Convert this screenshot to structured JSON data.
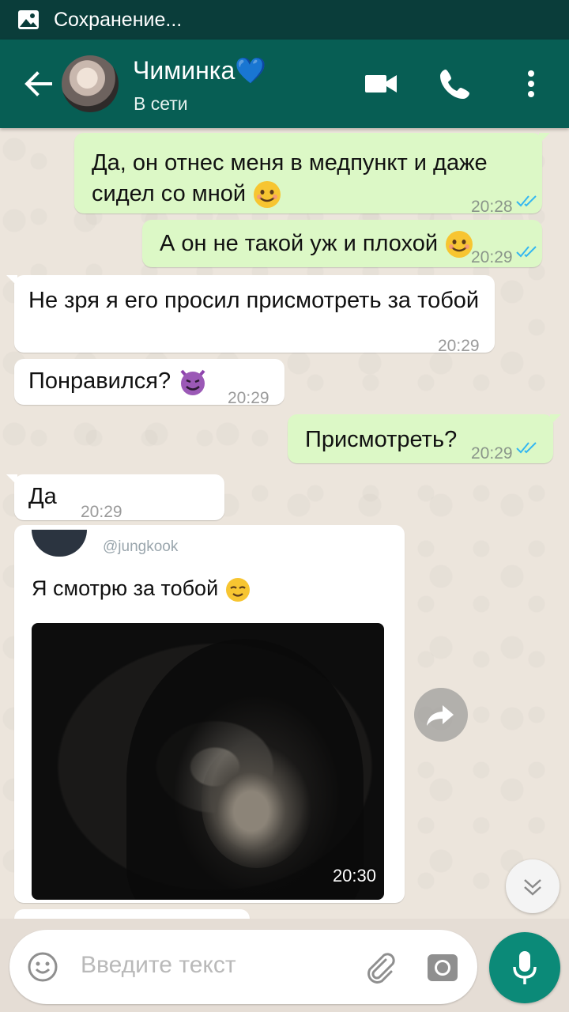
{
  "status_bar": {
    "text": "Сохранение...",
    "icon": "gallery-icon"
  },
  "header": {
    "back_icon": "arrow-back-icon",
    "contact_name": "Чиминка",
    "name_emoji": "💙",
    "presence": "В сети",
    "actions": [
      "video-call-icon",
      "voice-call-icon",
      "more-vert-icon"
    ]
  },
  "messages": [
    {
      "direction": "out",
      "lines": [
        "Да, он отнес меня в медпункт и даже",
        "сидел со мной"
      ],
      "time": "20:28",
      "status": "read"
    },
    {
      "direction": "out",
      "text": "А он не такой уж и плохой",
      "time": "20:29",
      "status": "read"
    },
    {
      "direction": "in",
      "text": "Не зря я его просил присмотреть за тобой",
      "time": "20:29"
    },
    {
      "direction": "in",
      "text": "Понравился?",
      "time": "20:29"
    },
    {
      "direction": "out",
      "text": "Присмотреть?",
      "time": "20:29",
      "status": "read"
    },
    {
      "direction": "in",
      "text": "Да",
      "time": "20:29"
    },
    {
      "direction": "in",
      "type": "image",
      "post_handle": "@jungkook",
      "post_text": "Я смотрю за тобой",
      "time": "20:30"
    }
  ],
  "composer": {
    "placeholder": "Введите текст",
    "icons": [
      "emoji-icon",
      "attach-icon",
      "camera-icon",
      "mic-icon"
    ]
  },
  "colors": {
    "header": "#075e54",
    "status_bar": "#0a3d3a",
    "outgoing": "#dcf8c6",
    "incoming": "#ffffff",
    "read_ticks": "#34b7f1",
    "mic_button": "#0b8a78"
  }
}
